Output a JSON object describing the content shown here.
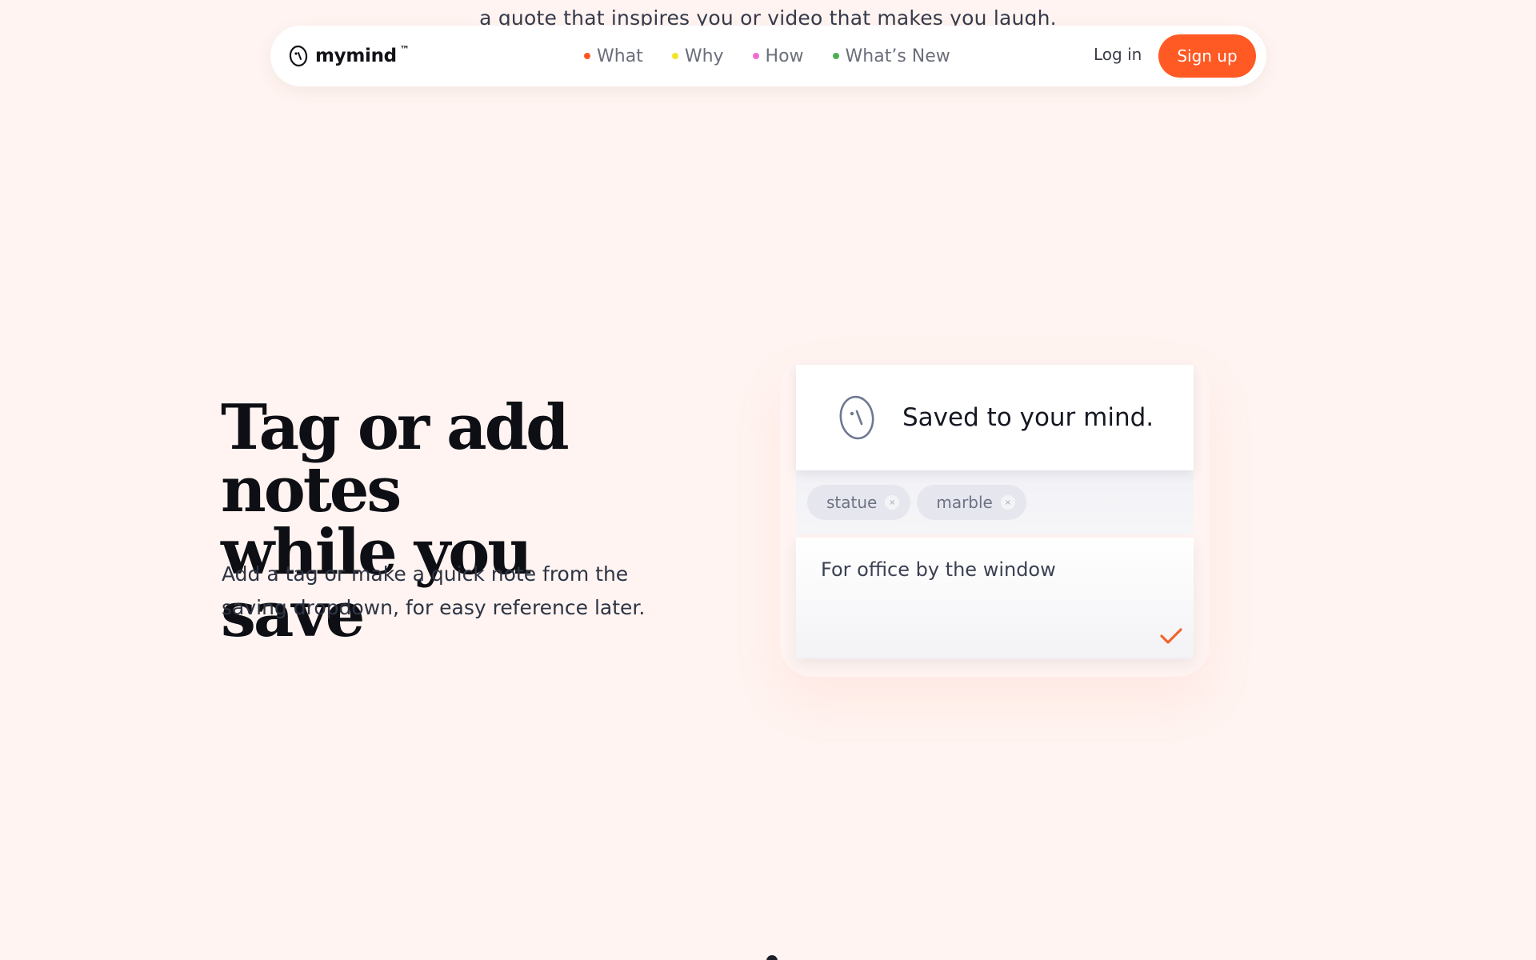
{
  "scroll_text": "a quote that inspires you or video that makes you laugh.",
  "navbar": {
    "brand": {
      "name": "mymind",
      "tm": "™"
    },
    "links": [
      {
        "label": "What",
        "dot_color": "#ff5924"
      },
      {
        "label": "Why",
        "dot_color": "#f2e42a"
      },
      {
        "label": "How",
        "dot_color": "#f36bd0"
      },
      {
        "label": "What’s New",
        "dot_color": "#4caf50"
      }
    ],
    "login_label": "Log in",
    "signup_label": "Sign up"
  },
  "hero": {
    "title_lines": [
      "Tag or add notes",
      "while you save"
    ],
    "description": "Add a tag or make a quick note from the saving dropdown, for easy reference later."
  },
  "card": {
    "saved_message": "Saved to your mind.",
    "tags": [
      {
        "label": "statue",
        "remove_glyph": "×"
      },
      {
        "label": "marble",
        "remove_glyph": "×"
      }
    ],
    "note_value": "For office by the window",
    "check_color": "#f2642e"
  },
  "colors": {
    "background": "#fff4f1",
    "accent": "#ff5924"
  }
}
